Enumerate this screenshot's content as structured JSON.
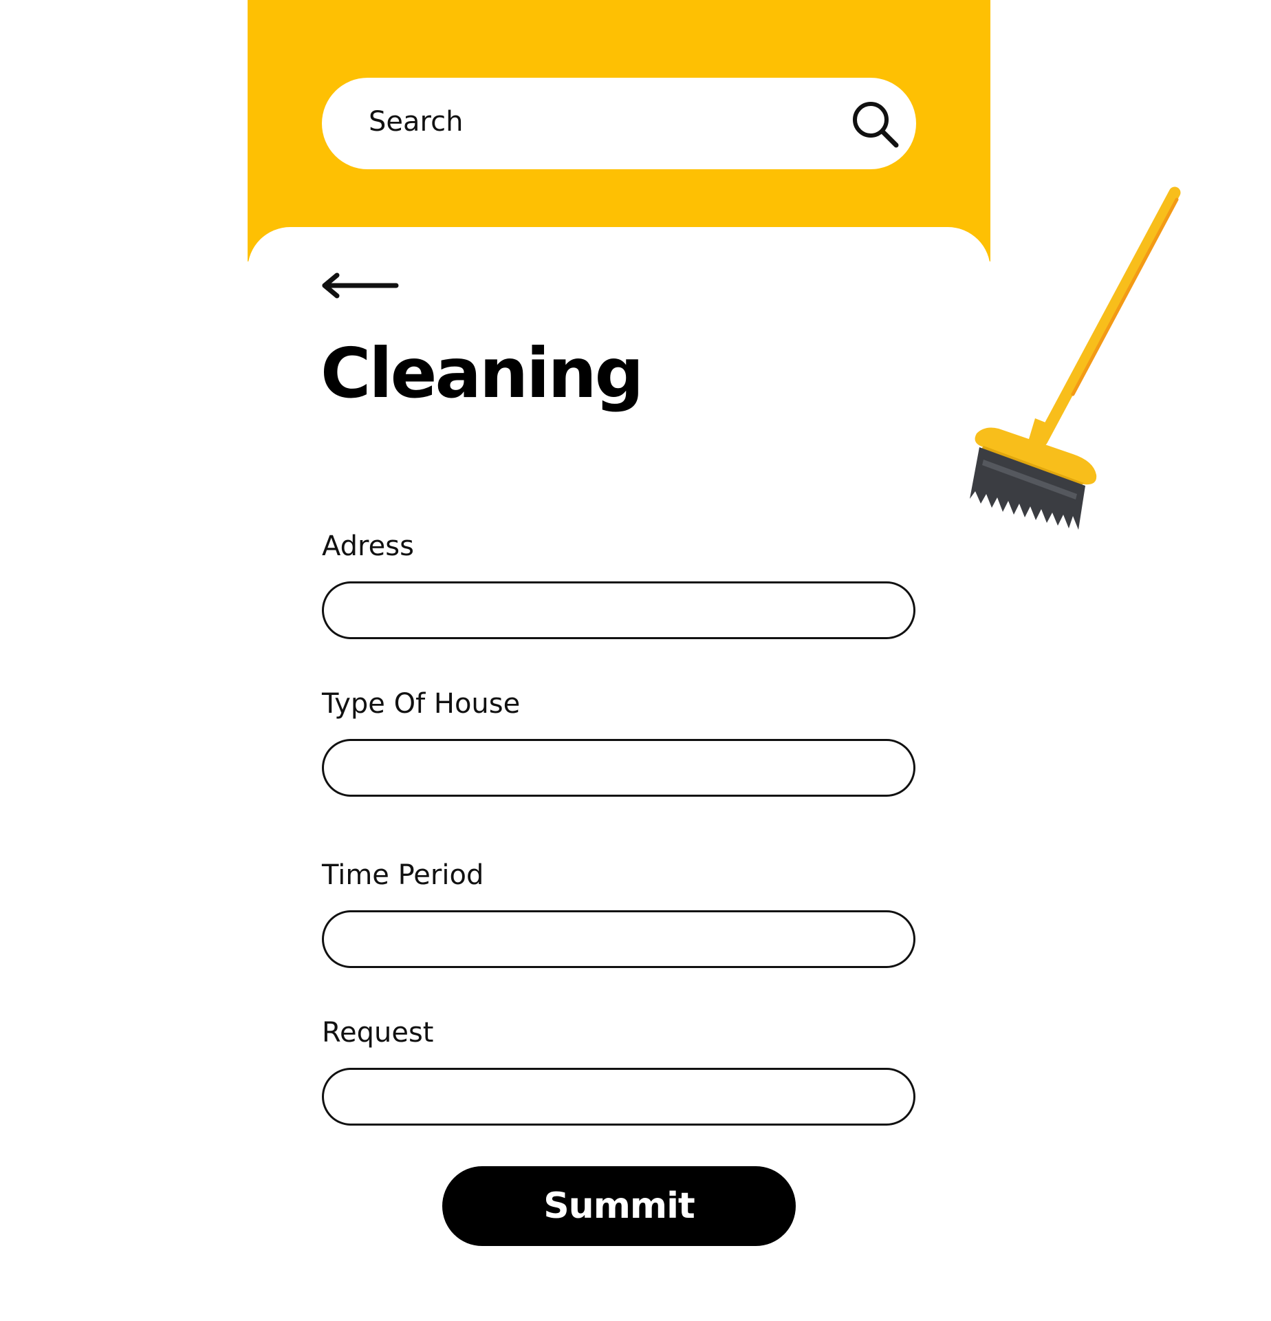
{
  "colors": {
    "header_background": "#FEC003",
    "card_background": "#FFFFFF",
    "text": "#000000",
    "button_background": "#000000",
    "button_text": "#FFFFFF"
  },
  "search": {
    "placeholder": "Search",
    "icon": "search-icon"
  },
  "nav": {
    "back_icon": "arrow-left-icon"
  },
  "page": {
    "title": "Cleaning",
    "illustration": "broom-icon"
  },
  "form": {
    "fields": [
      {
        "label": "Adress",
        "value": ""
      },
      {
        "label": "Type Of House",
        "value": ""
      },
      {
        "label": "Time Period",
        "value": ""
      },
      {
        "label": "Request",
        "value": ""
      }
    ],
    "submit_label": "Summit"
  }
}
